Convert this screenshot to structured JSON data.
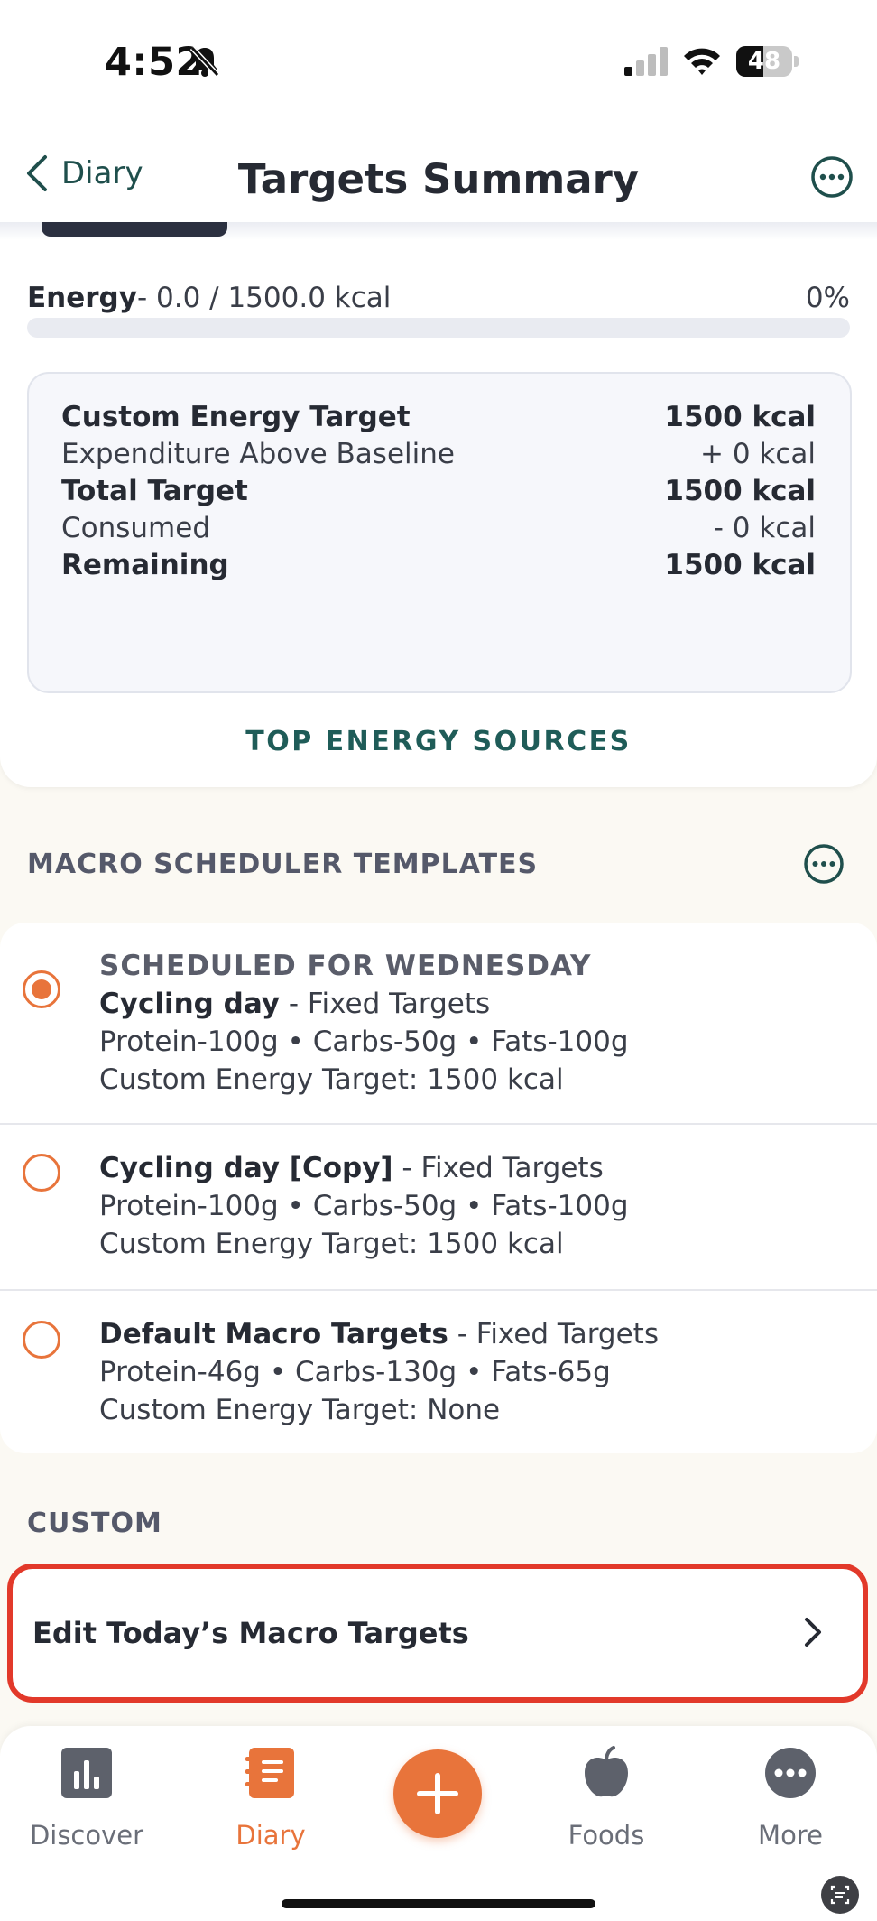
{
  "status_bar": {
    "time": "4:52",
    "battery": "48",
    "battery_level": 0.48
  },
  "nav": {
    "back_label": "Diary",
    "title": "Targets Summary"
  },
  "energy": {
    "label": "Energy",
    "detail": "- 0.0 / 1500.0 kcal",
    "percent": "0%",
    "progress": 0.0
  },
  "summary": {
    "rows": [
      {
        "label": "Custom Energy Target",
        "value": "1500 kcal"
      },
      {
        "label": "Expenditure Above Baseline",
        "value": "+ 0 kcal"
      },
      {
        "label": "Total Target",
        "value": "1500 kcal"
      },
      {
        "label": "Consumed",
        "value": "- 0 kcal"
      },
      {
        "label": "Remaining",
        "value": "1500 kcal"
      }
    ],
    "top_sources_label": "TOP ENERGY SOURCES"
  },
  "scheduler": {
    "section_title": "MACRO SCHEDULER TEMPLATES",
    "templates": [
      {
        "schedule_label": "SCHEDULED FOR WEDNESDAY",
        "name": "Cycling day",
        "type": " - Fixed Targets",
        "macros": "Protein-100g • Carbs-50g • Fats-100g",
        "energy": "Custom Energy Target: 1500 kcal",
        "selected": true
      },
      {
        "name": "Cycling day [Copy]",
        "type": " - Fixed Targets",
        "macros": "Protein-100g • Carbs-50g • Fats-100g",
        "energy": "Custom Energy Target: 1500 kcal",
        "selected": false
      },
      {
        "name": "Default Macro Targets",
        "type": " - Fixed Targets",
        "macros": "Protein-46g • Carbs-130g • Fats-65g",
        "energy": "Custom Energy Target: None",
        "selected": false
      }
    ]
  },
  "custom": {
    "section_title": "CUSTOM",
    "edit_label": "Edit Today’s Macro Targets"
  },
  "tabbar": {
    "tabs": [
      {
        "label": "Discover"
      },
      {
        "label": "Diary"
      },
      {
        "label": "Foods"
      },
      {
        "label": "More"
      }
    ],
    "colors": {
      "accent": "#e8743b",
      "primary_text": "#262a33",
      "teal": "#1f5c58",
      "highlight": "#e2392a"
    }
  }
}
